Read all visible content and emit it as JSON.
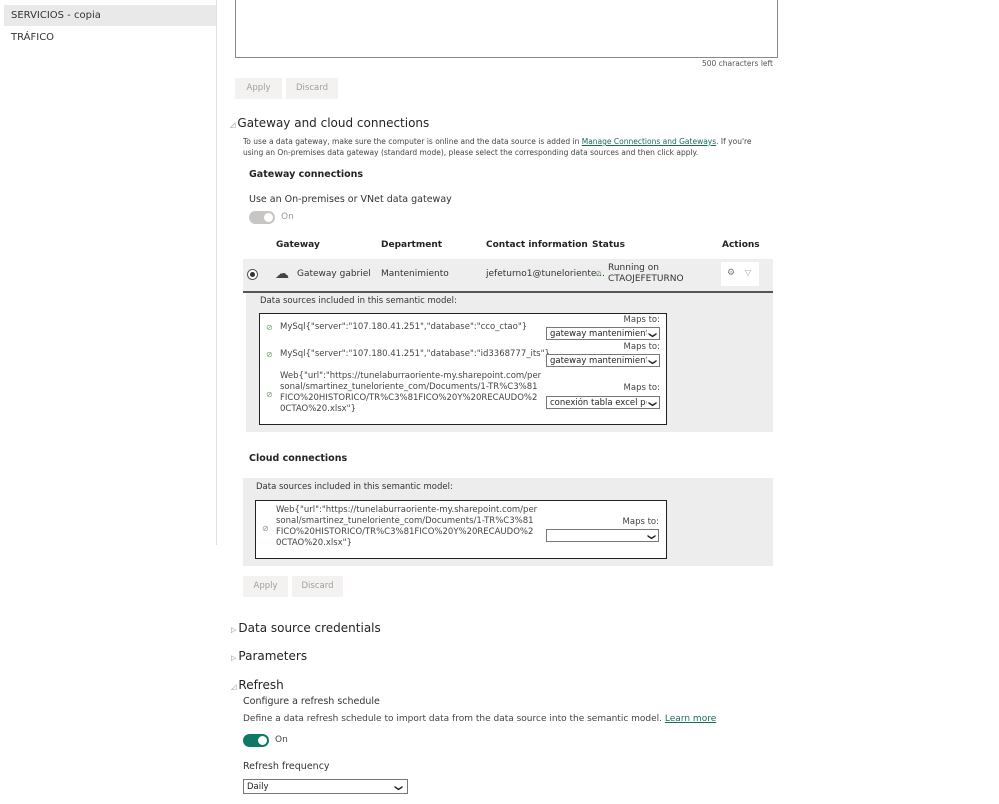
{
  "sidebar": {
    "items": [
      {
        "label": "SERVICIOS - copia",
        "selected": true
      },
      {
        "label": "TRÁFICO"
      }
    ]
  },
  "description_box": {
    "chars_left": "500 characters left",
    "apply": "Apply",
    "discard": "Discard"
  },
  "gateway_section": {
    "title": "Gateway and cloud connections",
    "desc_prefix": "To use a data gateway, make sure the computer is online and the data source is added in ",
    "desc_link": "Manage Connections and Gateways",
    "desc_suffix": ". If you're using an On-premises data gateway (standard mode), please select the corresponding data sources and then click apply.",
    "gateway_connections": "Gateway connections",
    "use_gateway_label": "Use an On-premises or VNet data gateway",
    "toggle_label": "On",
    "columns": [
      "Gateway",
      "Department",
      "Contact information",
      "Status",
      "Actions"
    ],
    "row": {
      "gateway": "Gateway gabriel",
      "department": "Mantenimiento",
      "contact": "jefeturno1@tuneloriente...",
      "status_line1": "Running on",
      "status_line2": "CTAOJEFETURNO"
    },
    "ds_label": "Data sources included in this semantic model:",
    "data_sources": [
      {
        "name": "MySql{\"server\":\"107.180.41.251\",\"database\":\"cco_ctao\"}",
        "maps_to_label": "Maps to:",
        "maps_to": "gateway mantenimiento"
      },
      {
        "name": "MySql{\"server\":\"107.180.41.251\",\"database\":\"id3368777_its\"}",
        "maps_to_label": "Maps to:",
        "maps_to": "gateway mantenimiento"
      },
      {
        "name": "Web{\"url\":\"https://tunelaburraoriente-my.sharepoint.com/personal/smartinez_tuneloriente_com/Documents/1-TR%C3%81FICO%20HISTORICO/TR%C3%81FICO%20Y%20RECAUDO%20CTAO%20.xlsx\"}",
        "maps_to_label": "Maps to:",
        "maps_to": "conexión tabla excel pe"
      }
    ],
    "cloud_connections": "Cloud connections",
    "cloud_ds_label": "Data sources included in this semantic model:",
    "cloud_sources": [
      {
        "name": "Web{\"url\":\"https://tunelaburraoriente-my.sharepoint.com/personal/smartinez_tuneloriente_com/Documents/1-TR%C3%81FICO%20HISTORICO/TR%C3%81FICO%20Y%20RECAUDO%20CTAO%20.xlsx\"}",
        "maps_to_label": "Maps to:",
        "maps_to": ""
      }
    ],
    "apply": "Apply",
    "discard": "Discard"
  },
  "sections": {
    "credentials": "Data source credentials",
    "parameters": "Parameters",
    "refresh": "Refresh"
  },
  "refresh": {
    "configure": "Configure a refresh schedule",
    "define": "Define a data refresh schedule to import data from the data source into the semantic model. ",
    "learn_more": "Learn more",
    "toggle_label": "On",
    "frequency_label": "Refresh frequency",
    "frequency": "Daily"
  },
  "colors": {
    "accent": "#117865",
    "panel": "#ededed"
  }
}
